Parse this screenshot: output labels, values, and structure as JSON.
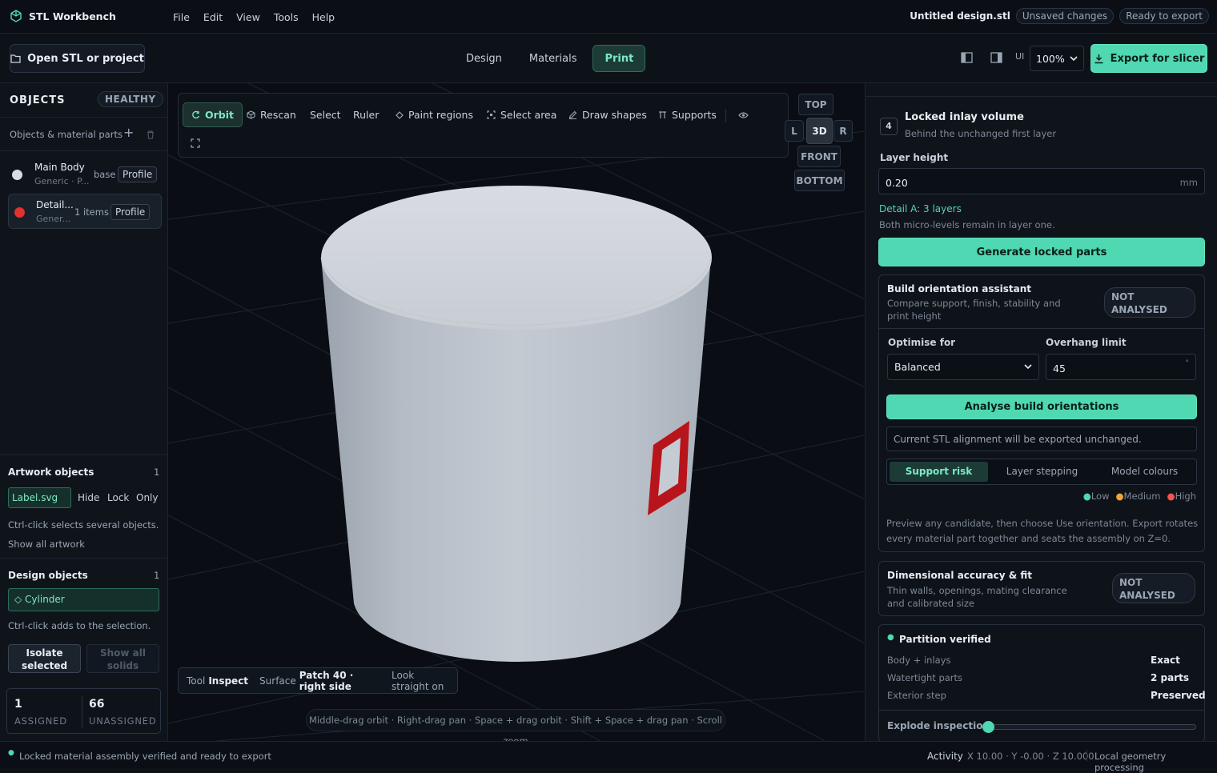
{
  "app": {
    "name": "STL Workbench",
    "menu": [
      "File",
      "Edit",
      "View",
      "Tools",
      "Help"
    ],
    "file_name": "Untitled design.stl",
    "badges": [
      "Unsaved changes",
      "Ready to export"
    ]
  },
  "toolbar": {
    "open_label": "Open STL or project",
    "tabs": [
      "Design",
      "Materials",
      "Print"
    ],
    "active_tab": "Print",
    "ui_label": "UI",
    "zoom": "100%",
    "export_label": "Export for slicer"
  },
  "left": {
    "objects_title": "OBJECTS",
    "health": "HEALTHY",
    "parts_label": "Objects & material parts",
    "objects": [
      {
        "name": "Main Body",
        "sub": "Generic · P...",
        "tag": "base",
        "action": "Profile",
        "color": "#d9dde3"
      },
      {
        "name": "Detail...",
        "sub": "Gener...",
        "tag": "1 items",
        "action": "Profile",
        "color": "#e0322e"
      }
    ],
    "artwork": {
      "title": "Artwork objects",
      "count": "1",
      "item": "Label.svg",
      "actions": [
        "Hide",
        "Lock",
        "Only"
      ],
      "hint": "Ctrl-click selects several objects.",
      "show_all": "Show all artwork"
    },
    "design": {
      "title": "Design objects",
      "count": "1",
      "item": "◇ Cylinder",
      "hint": "Ctrl-click adds to the selection.",
      "isolate": "Isolate selected",
      "show_all": "Show all solids"
    },
    "stats": {
      "assigned": "1",
      "assigned_label": "ASSIGNED",
      "unassigned": "66",
      "unassigned_label": "UNASSIGNED"
    }
  },
  "viewport": {
    "tools": [
      "Orbit",
      "Rescan",
      "Select",
      "Ruler",
      "Paint regions",
      "Select area",
      "Draw shapes",
      "Supports"
    ],
    "active_tool": "Orbit",
    "views": {
      "top": "TOP",
      "left": "L",
      "d3": "3D",
      "right": "R",
      "front": "FRONT",
      "bottom": "BOTTOM"
    },
    "info": {
      "tool_label": "Tool",
      "tool": "Inspect",
      "surface_label": "Surface",
      "surface": "Patch 40 · right side",
      "look": "Look straight on"
    },
    "hint": "Middle-drag orbit · Right-drag pan · Space + drag orbit · Shift + Space + drag pan · Scroll zoom"
  },
  "right": {
    "step": "4",
    "title": "Locked inlay volume",
    "subtitle": "Behind the unchanged first layer",
    "layer_label": "Layer height",
    "layer_value": "0.20",
    "layer_unit": "mm",
    "detail": "Detail A: 3 layers",
    "detail_note": "Both micro-levels remain in layer one.",
    "generate": "Generate locked parts",
    "orient": {
      "title": "Build orientation assistant",
      "desc": "Compare support, finish, stability and print height",
      "status": "NOT ANALYSED",
      "optimise_label": "Optimise for",
      "optimise_value": "Balanced",
      "overhang_label": "Overhang limit",
      "overhang_value": "45",
      "overhang_unit": "°",
      "analyse": "Analyse build orientations",
      "note": "Current STL alignment will be exported unchanged.",
      "modes": [
        "Support risk",
        "Layer stepping",
        "Model colours"
      ],
      "legend": [
        {
          "label": "Low",
          "color": "#4fd8b1"
        },
        {
          "label": "Medium",
          "color": "#f2a33a"
        },
        {
          "label": "High",
          "color": "#f0564f"
        }
      ],
      "help": "Preview any candidate, then choose Use orientation. Export rotates every material part together and seats the assembly on Z=0."
    },
    "dims": {
      "title": "Dimensional accuracy & fit",
      "desc": "Thin walls, openings, mating clearance and calibrated size",
      "status": "NOT ANALYSED"
    },
    "partition": {
      "title": "Partition verified",
      "rows": [
        {
          "label": "Body + inlays",
          "value": "Exact"
        },
        {
          "label": "Watertight parts",
          "value": "2 parts"
        },
        {
          "label": "Exterior step",
          "value": "Preserved"
        }
      ],
      "explode_label": "Explode inspection",
      "explode": 0
    }
  },
  "status": {
    "message": "Locked material assembly verified and ready to export",
    "activity": "Activity",
    "coords": "X 10.00 · Y -0.00 · Z 10.000",
    "processing": "Local geometry processing"
  },
  "colors": {
    "accent": "#4fd8b1",
    "inlay": "#c0141c",
    "body": "#c6ccd4"
  }
}
